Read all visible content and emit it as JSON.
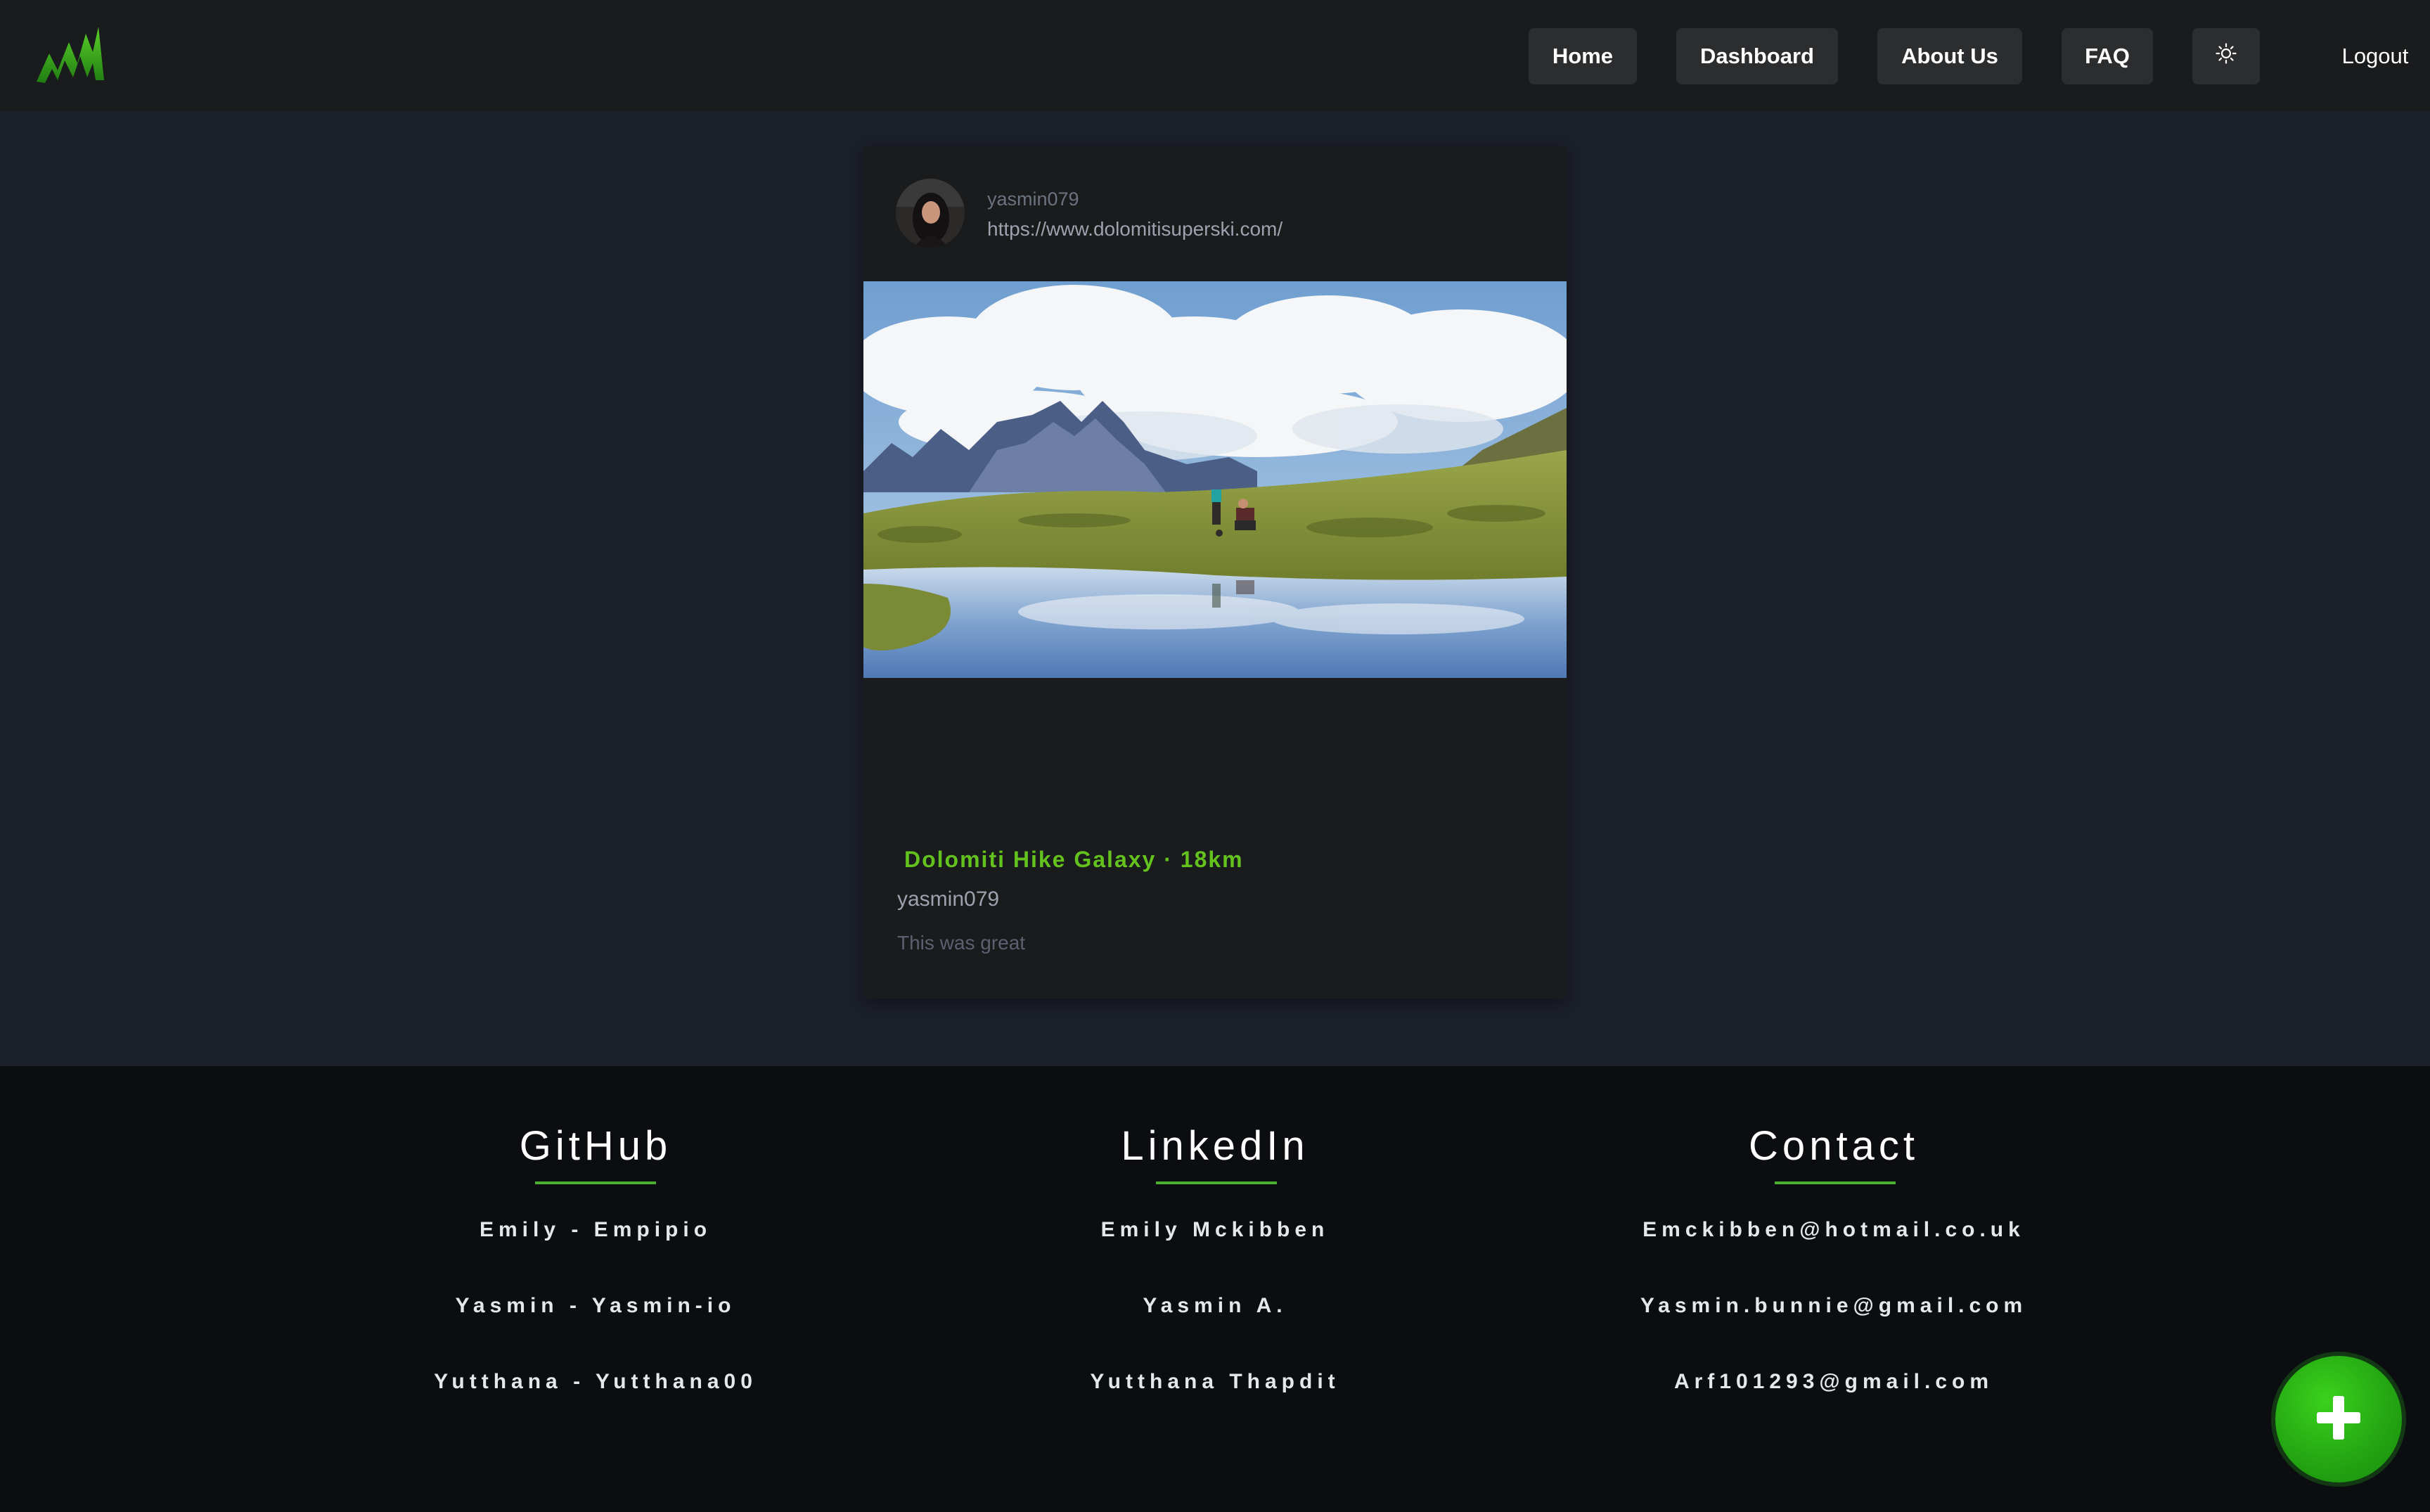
{
  "nav": {
    "home": "Home",
    "dashboard": "Dashboard",
    "about": "About Us",
    "faq": "FAQ",
    "theme_icon": "sun-icon",
    "logout": "Logout",
    "logo_icon": "mountain-logo-icon",
    "accent_color": "#4caf30"
  },
  "post": {
    "username": "yasmin079",
    "url": "https://www.dolomitisuperski.com/",
    "title": "Dolomiti Hike Galaxy · 18km",
    "author": "yasmin079",
    "body": "This was great",
    "title_color": "#64c21f"
  },
  "footer": {
    "github": {
      "heading": "GitHub",
      "items": [
        "Emily - Empipio",
        "Yasmin - Yasmin-io",
        "Yutthana - Yutthana00"
      ]
    },
    "linkedin": {
      "heading": "LinkedIn",
      "items": [
        "Emily Mckibben",
        "Yasmin A.",
        "Yutthana Thapdit"
      ]
    },
    "contact": {
      "heading": "Contact",
      "items": [
        "Emckibben@hotmail.co.uk",
        "Yasmin.bunnie@gmail.com",
        "Arf101293@gmail.com"
      ]
    }
  },
  "fab": {
    "icon": "plus-icon",
    "color": "#23a412"
  }
}
